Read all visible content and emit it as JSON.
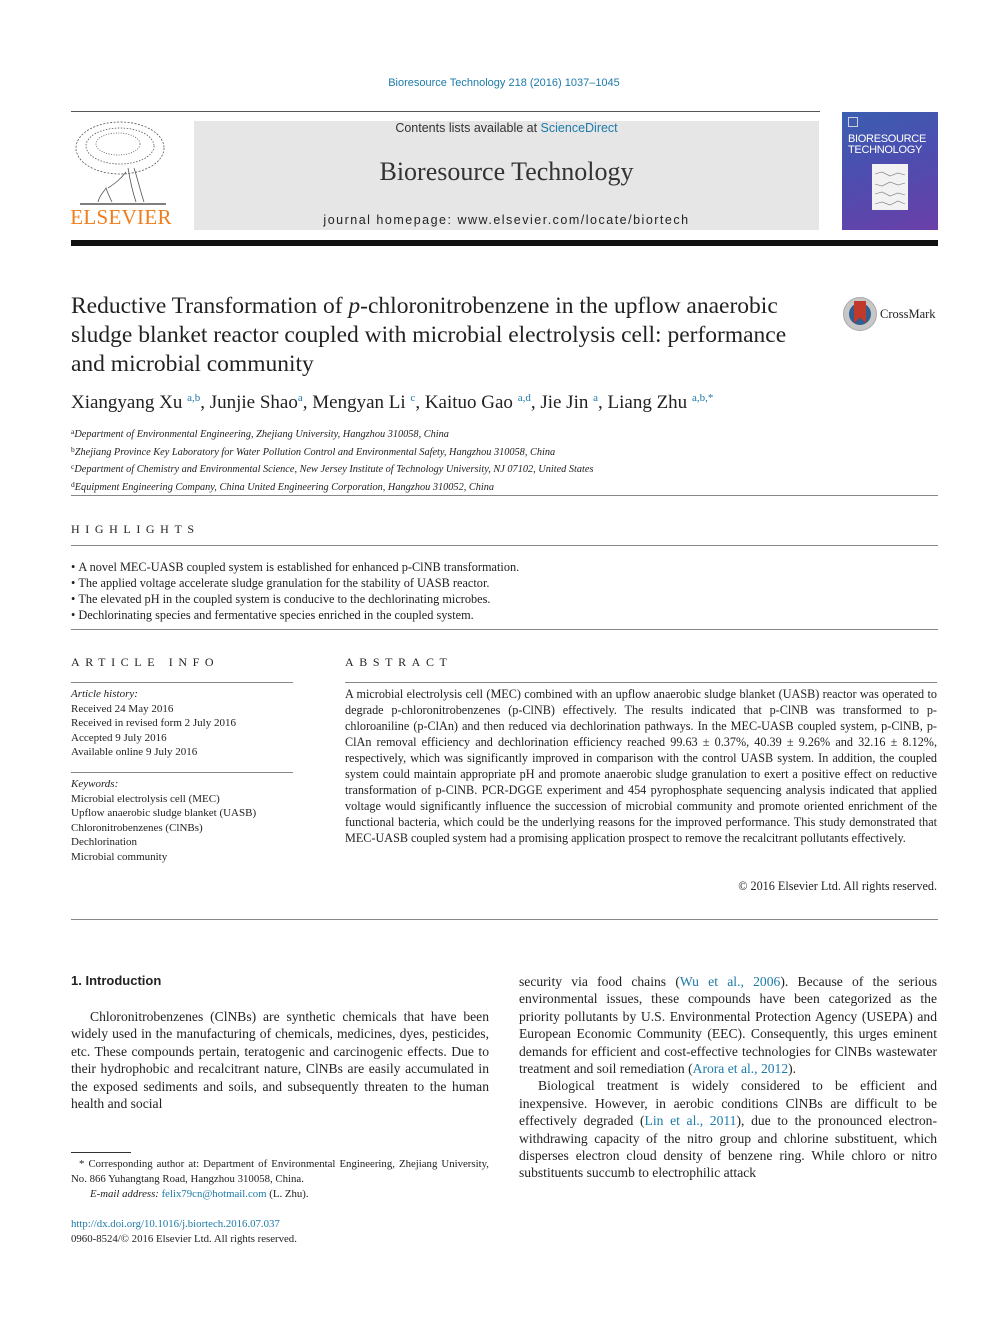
{
  "header": {
    "journal_citation": "Bioresource Technology 218 (2016) 1037–1045",
    "contents_prefix": "Contents lists available at ",
    "contents_link": "ScienceDirect",
    "journal_title": "Bioresource Technology",
    "homepage_prefix": "journal homepage: ",
    "homepage_url": "www.elsevier.com/locate/biortech",
    "publisher_logo_text": "ELSEVIER",
    "cover_title_line1": "BIORESOURCE",
    "cover_title_line2": "TECHNOLOGY",
    "crossmark_label": "CrossMark"
  },
  "article": {
    "title_part1": "Reductive Transformation of ",
    "title_italic": "p",
    "title_part2": "-chloronitrobenzene in the upflow anaerobic sludge blanket reactor coupled with microbial electrolysis cell: performance and microbial community",
    "authors": [
      {
        "name": "Xiangyang Xu",
        "sup": "a,b"
      },
      {
        "name": "Junjie Shao",
        "sup": "a"
      },
      {
        "name": "Mengyan Li",
        "sup": "c"
      },
      {
        "name": "Kaituo Gao",
        "sup": "a,d"
      },
      {
        "name": "Jie Jin",
        "sup": "a"
      },
      {
        "name": "Liang Zhu",
        "sup": "a,b,*"
      }
    ],
    "affiliations": [
      {
        "key": "a",
        "text": "Department of Environmental Engineering, Zhejiang University, Hangzhou 310058, China"
      },
      {
        "key": "b",
        "text": "Zhejiang Province Key Laboratory for Water Pollution Control and Environmental Safety, Hangzhou 310058, China"
      },
      {
        "key": "c",
        "text": "Department of Chemistry and Environmental Science, New Jersey Institute of Technology University, NJ 07102, United States"
      },
      {
        "key": "d",
        "text": "Equipment Engineering Company, China United Engineering Corporation, Hangzhou 310052, China"
      }
    ]
  },
  "highlights": {
    "heading": "HIGHLIGHTS",
    "items": [
      "A novel MEC-UASB coupled system is established for enhanced p-ClNB transformation.",
      "The applied voltage accelerate sludge granulation for the stability of UASB reactor.",
      "The elevated pH in the coupled system is conducive to the dechlorinating microbes.",
      "Dechlorinating species and fermentative species enriched in the coupled system."
    ]
  },
  "article_info": {
    "heading": "ARTICLE INFO",
    "history_label": "Article history:",
    "history": [
      "Received 24 May 2016",
      "Received in revised form 2 July 2016",
      "Accepted 9 July 2016",
      "Available online 9 July 2016"
    ],
    "keywords_label": "Keywords:",
    "keywords": [
      "Microbial electrolysis cell (MEC)",
      "Upflow anaerobic sludge blanket (UASB)",
      "Chloronitrobenzenes (ClNBs)",
      "Dechlorination",
      "Microbial community"
    ]
  },
  "abstract": {
    "heading": "ABSTRACT",
    "text": "A microbial electrolysis cell (MEC) combined with an upflow anaerobic sludge blanket (UASB) reactor was operated to degrade p-chloronitrobenzenes (p-ClNB) effectively. The results indicated that p-ClNB was transformed to p-chloroaniline (p-ClAn) and then reduced via dechlorination pathways. In the MEC-UASB coupled system, p-ClNB, p-ClAn removal efficiency and dechlorination efficiency reached 99.63 ± 0.37%, 40.39 ± 9.26% and 32.16 ± 8.12%, respectively, which was significantly improved in comparison with the control UASB system. In addition, the coupled system could maintain appropriate pH and promote anaerobic sludge granulation to exert a positive effect on reductive transformation of p-ClNB. PCR-DGGE experiment and 454 pyrophosphate sequencing analysis indicated that applied voltage would significantly influence the succession of microbial community and promote oriented enrichment of the functional bacteria, which could be the underlying reasons for the improved performance. This study demonstrated that MEC-UASB coupled system had a promising application prospect to remove the recalcitrant pollutants effectively.",
    "copyright": "© 2016 Elsevier Ltd. All rights reserved."
  },
  "body": {
    "section_title": "1. Introduction",
    "left_para": "Chloronitrobenzenes (ClNBs) are synthetic chemicals that have been widely used in the manufacturing of chemicals, medicines, dyes, pesticides, etc. These compounds pertain, teratogenic and carcinogenic effects. Due to their hydrophobic and recalcitrant nature, ClNBs are easily accumulated in the exposed sediments and soils, and subsequently threaten to the human health and social",
    "right_p1_a": "security via food chains (",
    "right_p1_cite1": "Wu et al., 2006",
    "right_p1_b": "). Because of the serious environmental issues, these compounds have been categorized as the priority pollutants by U.S. Environmental Protection Agency (USEPA) and European Economic Community (EEC). Consequently, this urges eminent demands for efficient and cost-effective technologies for ClNBs wastewater treatment and soil remediation (",
    "right_p1_cite2": "Arora et al., 2012",
    "right_p1_c": ").",
    "right_p2_a": "Biological treatment is widely considered to be efficient and inexpensive. However, in aerobic conditions ClNBs are difficult to be effectively degraded (",
    "right_p2_cite": "Lin et al., 2011",
    "right_p2_b": "), due to the pronounced electron-withdrawing capacity of the nitro group and chlorine substituent, which disperses electron cloud density of benzene ring. While chloro or nitro substituents succumb to electrophilic attack"
  },
  "footnote": {
    "corresponding": "* Corresponding author at: Department of Environmental Engineering, Zhejiang University, No. 866 Yuhangtang Road, Hangzhou 310058, China.",
    "email_label": "E-mail address: ",
    "email": "felix79cn@hotmail.com",
    "email_suffix": " (L. Zhu).",
    "doi": "http://dx.doi.org/10.1016/j.biortech.2016.07.037",
    "issn": "0960-8524/© 2016 Elsevier Ltd. All rights reserved."
  }
}
